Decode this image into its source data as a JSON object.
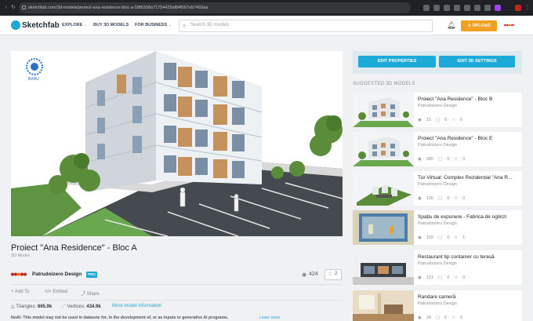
{
  "browser": {
    "url": "sketchfab.com/3d-models/proiect-ana-residence-bloc-a-58f6308a71754429af84f007e57459aa"
  },
  "header": {
    "logo": "Sketchfab",
    "nav": [
      "EXPLORE",
      "BUY 3D MODELS",
      "FOR BUSINESS"
    ],
    "search_placeholder": "Search 3D models",
    "upload_label": "UPLOAD"
  },
  "model": {
    "title": "Proiect \"Ana Residence\" - Bloc A",
    "subtitle": "3D Model",
    "author": "Patrudoizero Design",
    "badge": "PRO",
    "views": "424",
    "likes": "2",
    "actions": [
      "Add To",
      "Embed",
      "Share"
    ],
    "triangles_label": "Triangles:",
    "triangles": "665.9k",
    "vertices_label": "Vertices:",
    "vertices": "434.9k",
    "more_info": "More model information",
    "noai": "NoAI: This model may not be used in datasets for, in the development of, or as inputs to generative AI programs.",
    "learn_more": "Learn more",
    "watermark": "BANU"
  },
  "panel": {
    "edit_properties": "EDIT PROPERTIES",
    "edit_3d": "EDIT 3D SETTINGS",
    "suggested_title": "SUGGESTED 3D MODELS"
  },
  "suggestions": [
    {
      "title": "Proiect \"Ana Residence\" - Bloc B",
      "author": "Patrudoizero Design",
      "views": "15",
      "comments": "0",
      "likes": "0",
      "thumb": "building-white"
    },
    {
      "title": "Proiect \"Ana Residence\" - Bloc E",
      "author": "Patrudoizero Design",
      "views": "280",
      "comments": "0",
      "likes": "0",
      "thumb": "building-white"
    },
    {
      "title": "Tur Virtual: Complex Rezidențial \"Ana R...",
      "author": "Patrudoizero Design",
      "views": "130",
      "comments": "0",
      "likes": "0",
      "thumb": "complex"
    },
    {
      "title": "Spațiu de expunere - Fabrica de oglinzi",
      "author": "Patrudoizero Design",
      "views": "192",
      "comments": "0",
      "likes": "1",
      "thumb": "showroom"
    },
    {
      "title": "Restaurant tip container cu terasă",
      "author": "Patrudoizero Design",
      "views": "121",
      "comments": "0",
      "likes": "0",
      "thumb": "container"
    },
    {
      "title": "Randare cameră",
      "author": "Patrudoizero Design",
      "views": "24",
      "comments": "0",
      "likes": "0",
      "thumb": "room"
    }
  ]
}
